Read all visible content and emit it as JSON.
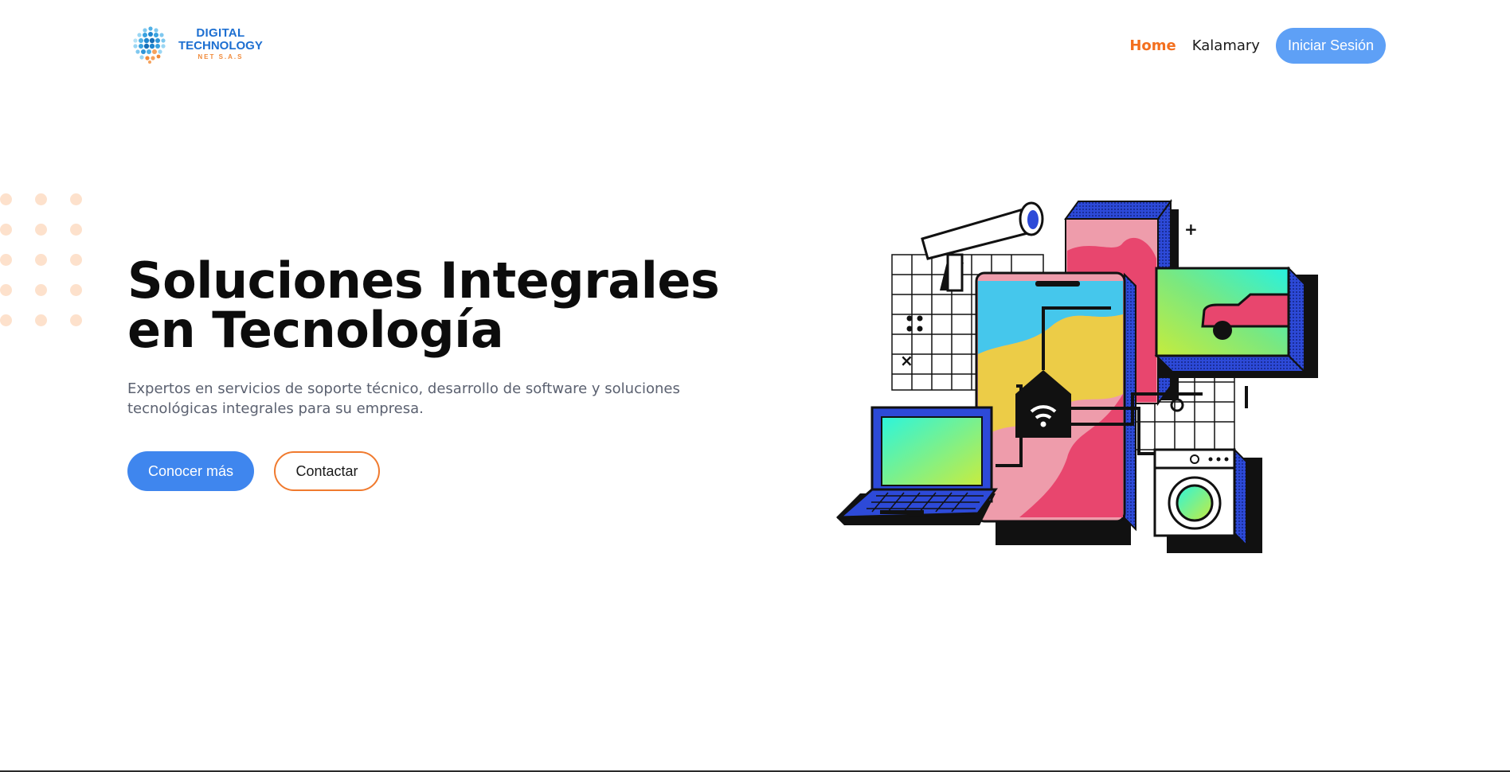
{
  "brand": {
    "line1": "DIGITAL",
    "line2": "TECHNOLOGY",
    "line3": "NET S.A.S",
    "icon": "globe-dots-logo"
  },
  "nav": {
    "items": [
      {
        "label": "Home",
        "active": true
      },
      {
        "label": "Kalamary",
        "active": false
      }
    ],
    "login_label": "Iniciar Sesión"
  },
  "hero": {
    "title": "Soluciones Integrales en Tecnología",
    "subtitle": "Expertos en servicios de soporte técnico, desarrollo de software y soluciones tecnológicas integrales para su empresa.",
    "primary_cta": "Conocer más",
    "secondary_cta": "Contactar"
  },
  "colors": {
    "accent_orange": "#f36f1e",
    "primary_blue": "#3f86ee",
    "login_blue": "#5ea0f6",
    "dot_peach": "#fde1cc"
  }
}
